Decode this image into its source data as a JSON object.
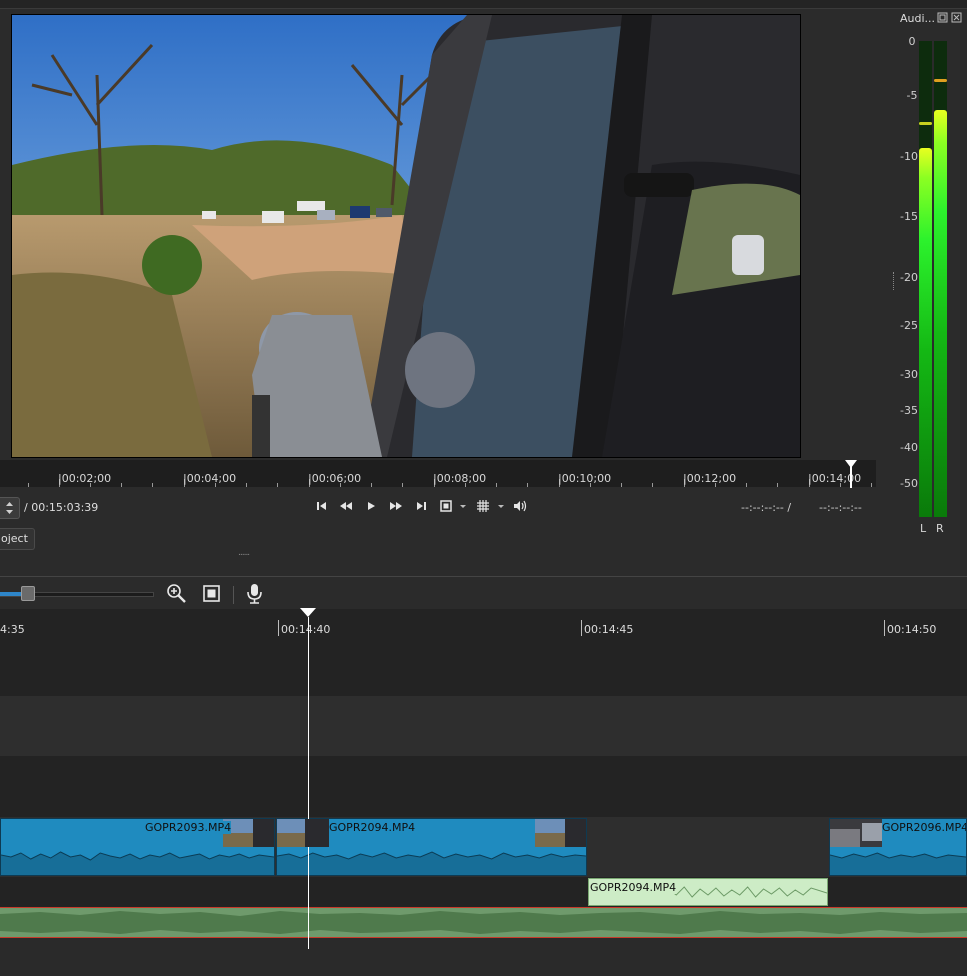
{
  "viewer": {
    "ruler_labels": [
      "|00:02;00",
      "|00:04;00",
      "|00:06;00",
      "|00:08;00",
      "|00:10;00",
      "|00:12;00",
      "|00:14;00"
    ],
    "duration": "/ 00:15:03:39",
    "in_point": "--:--:--:-- /",
    "out_point": "--:--:--:--",
    "project_tab": "oject",
    "splitter": "......"
  },
  "transport": {
    "skip_start_icon": "skip-to-start-icon",
    "rewind_icon": "rewind-icon",
    "play_icon": "play-icon",
    "fast_forward_icon": "fast-forward-icon",
    "skip_end_icon": "skip-to-end-icon",
    "zoom_fit_icon": "fit-frame-icon",
    "grid_icon": "grid-icon",
    "volume_icon": "volume-icon"
  },
  "audio_meter": {
    "title": "Audi...",
    "scale": [
      "0",
      "-5",
      "-10",
      "-15",
      "-20",
      "-25",
      "-30",
      "-35",
      "-40",
      "-50"
    ],
    "channels": [
      "L",
      "R"
    ],
    "left_level_db": -9.5,
    "right_level_db": -6.5,
    "left_peak_db": -7.0,
    "right_peak_db": -3.5,
    "colors": {
      "low": "#0a7a0a",
      "high": "#e8ff20",
      "peak_left": "#c8d020",
      "peak_right": "#e0a020"
    }
  },
  "timeline": {
    "ruler_labels": [
      "4:35",
      "00:14:40",
      "00:14:45",
      "00:14:50"
    ],
    "video_clips": [
      {
        "name": "GOPR2093.MP4"
      },
      {
        "name": "GOPR2094.MP4"
      },
      {
        "name": "GOPR2096.MP4"
      }
    ],
    "audio_clips": [
      {
        "name": "GOPR2094.MP4"
      }
    ],
    "colors": {
      "video_clip": "#1f8bbf",
      "audio_clip": "#cdecc6",
      "master_audio": "#5c8a5c",
      "playhead": "#ffffff"
    }
  },
  "toolbar": {
    "zoom_in_icon": "zoom-in-icon",
    "zoom_fit_icon": "zoom-fit-icon",
    "record_icon": "microphone-icon"
  }
}
